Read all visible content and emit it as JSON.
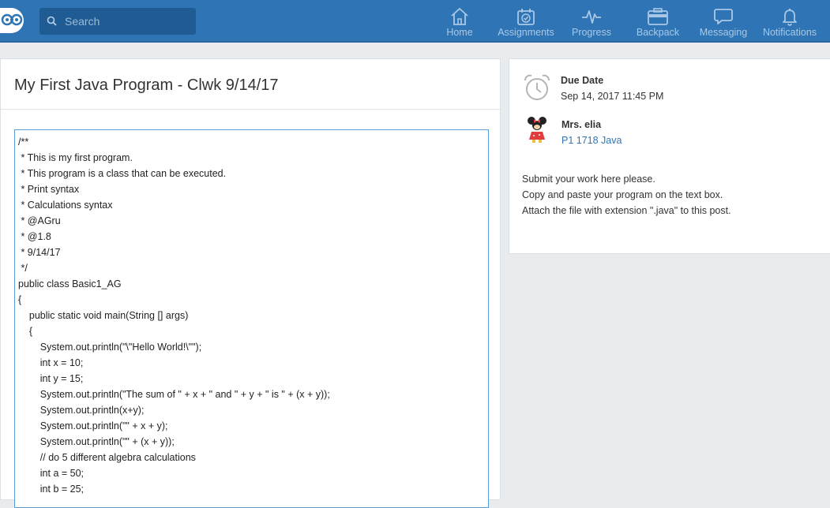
{
  "header": {
    "search_placeholder": "Search",
    "nav": [
      {
        "label": "Home",
        "icon": "home-icon"
      },
      {
        "label": "Assignments",
        "icon": "assignments-icon"
      },
      {
        "label": "Progress",
        "icon": "progress-icon"
      },
      {
        "label": "Backpack",
        "icon": "backpack-icon"
      },
      {
        "label": "Messaging",
        "icon": "messaging-icon"
      },
      {
        "label": "Notifications",
        "icon": "notifications-icon"
      }
    ]
  },
  "assignment": {
    "title": "My First Java Program - Clwk 9/14/17",
    "code_lines": [
      "/**",
      " * This is my first program.",
      " * This program is a class that can be executed.",
      " * Print syntax",
      " * Calculations syntax",
      " * @AGru",
      " * @1.8",
      " * 9/14/17",
      " */",
      "public class Basic1_AG",
      "{",
      "    public static void main(String [] args)",
      "    {",
      "        System.out.println(\"\\\"Hello World!\\\"\");",
      "        int x = 10;",
      "        int y = 15;",
      "        System.out.println(\"The sum of \" + x + \" and \" + y + \" is \" + (x + y));",
      "        System.out.println(x+y);",
      "        System.out.println(\"\" + x + y);",
      "        System.out.println(\"\" + (x + y));",
      "        // do 5 different algebra calculations",
      "        int a = 50;",
      "        int b = 25;"
    ]
  },
  "details": {
    "due_label": "Due Date",
    "due_date": "Sep 14, 2017 11:45 PM",
    "teacher": "Mrs. elia",
    "group": "P1 1718 Java",
    "description": [
      "Submit your work here please.",
      "Copy and paste your program on the text box.",
      "Attach the file with extension \".java\" to this post."
    ]
  },
  "colors": {
    "header_bg": "#2f75b5",
    "search_bg": "#1f5c93",
    "nav_text": "#a9c8e6",
    "link": "#2f75b5",
    "editor_border": "#5b9bd5"
  }
}
